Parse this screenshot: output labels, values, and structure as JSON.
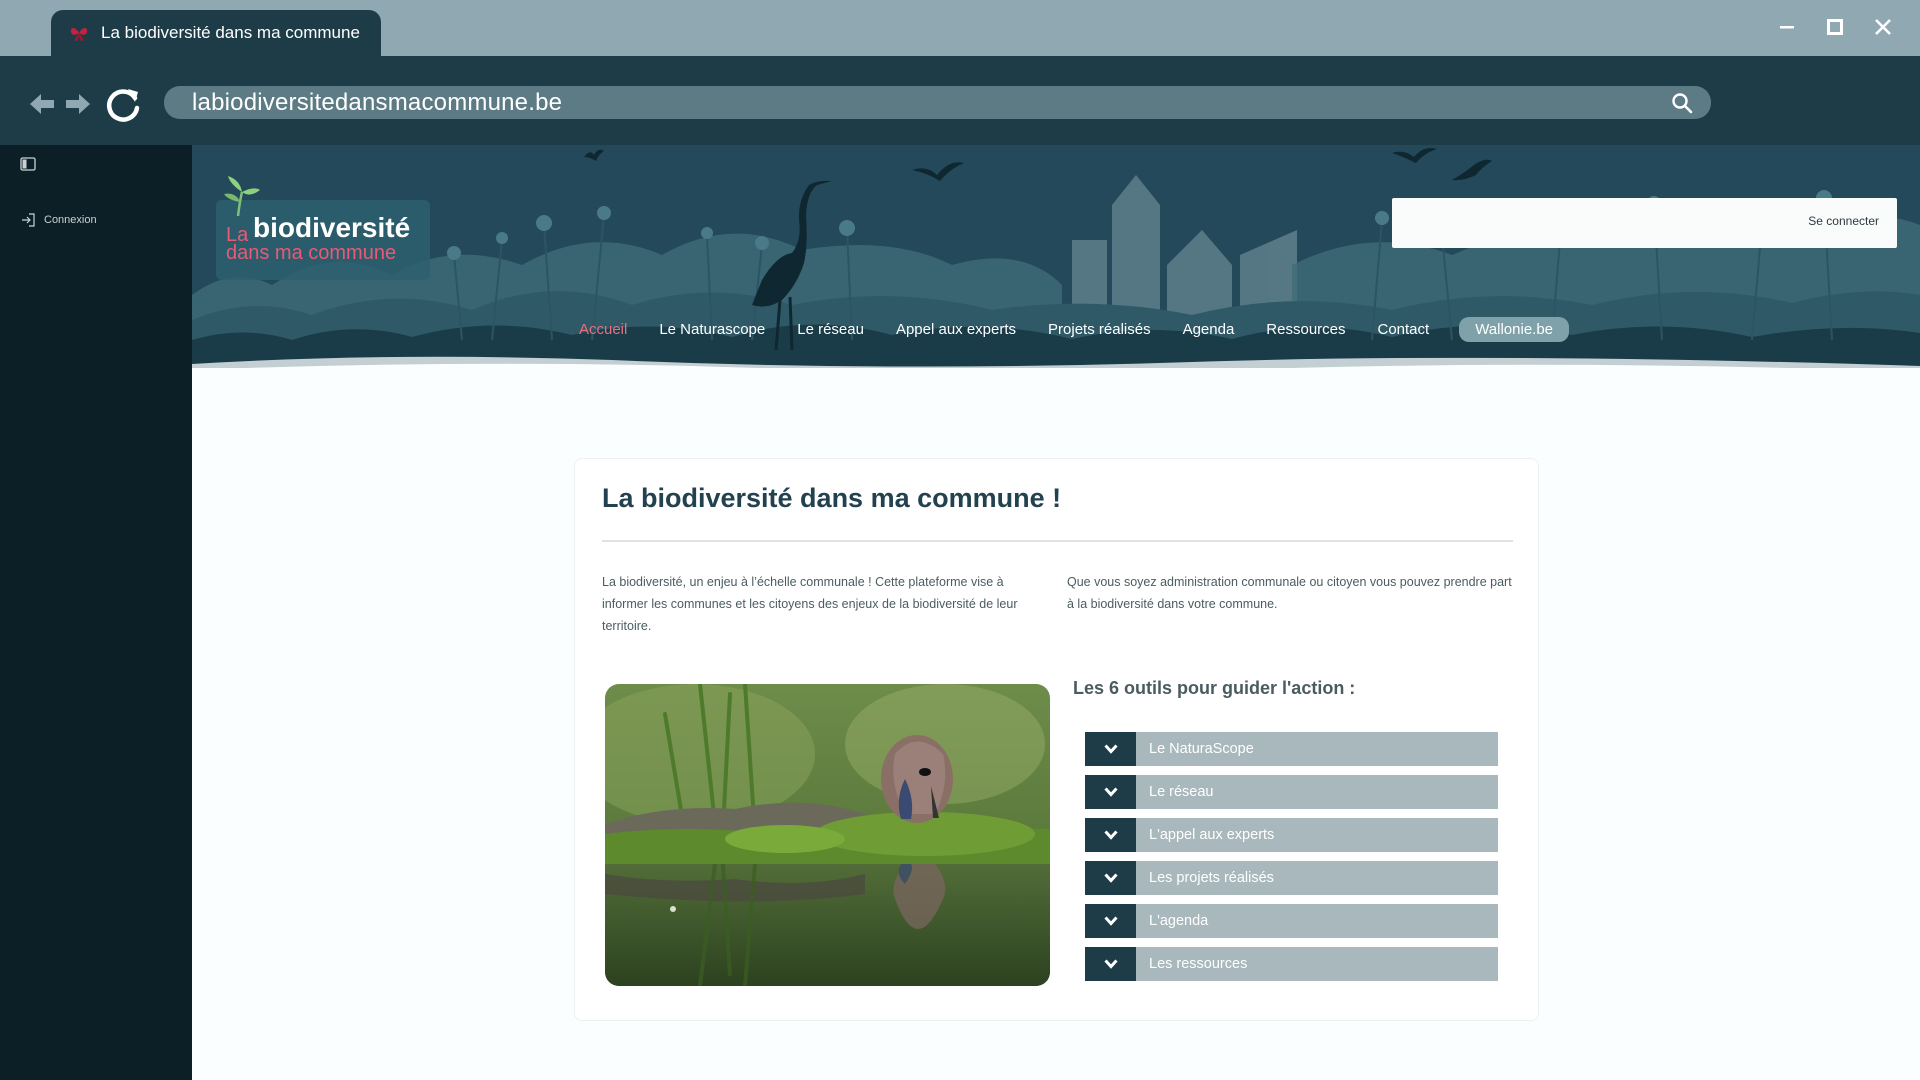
{
  "browser": {
    "tab_title": "La biodiversité dans ma commune",
    "url": "labiodiversitedansmacommune.be"
  },
  "sidebar": {
    "login_label": "Connexion"
  },
  "header": {
    "logo": {
      "la": "La",
      "main": "biodiversité",
      "sub": "dans ma commune"
    },
    "search_placeholder": "",
    "login_label": "Se connecter"
  },
  "menu": {
    "items": [
      {
        "label": "Accueil",
        "active": true
      },
      {
        "label": "Le Naturascope",
        "active": false
      },
      {
        "label": "Le réseau",
        "active": false
      },
      {
        "label": "Appel aux experts",
        "active": false
      },
      {
        "label": "Projets réalisés",
        "active": false
      },
      {
        "label": "Agenda",
        "active": false
      },
      {
        "label": "Ressources",
        "active": false
      },
      {
        "label": "Contact",
        "active": false
      }
    ],
    "highlight": "Wallonie.be"
  },
  "content": {
    "title": "La biodiversité dans ma commune !",
    "intro_left": "La biodiversité, un enjeu à l’échelle communale ! Cette plateforme vise à informer les communes et les citoyens des enjeux de la biodiversité de leur territoire.",
    "intro_right": "Que vous soyez administration communale ou citoyen vous pouvez prendre part à la biodiversité dans votre commune.",
    "tools_heading": "Les 6 outils pour guider l'action :",
    "tools": [
      "Le NaturaScope",
      "Le réseau",
      "L'appel aux experts",
      "Les projets réalisés",
      "L'agenda",
      "Les ressources"
    ]
  },
  "colors": {
    "chrome_bg": "#8fa8b2",
    "toolbar_bg": "#1d3c48",
    "sidebar_bg": "#0c1f26",
    "accent_pink": "#e86f80",
    "accordion_toggle": "#1d3c48",
    "accordion_label_bg": "#a9b8bc"
  },
  "icons": [
    "butterfly-favicon-icon",
    "minimize-icon",
    "maximize-icon",
    "close-icon",
    "back-arrow-icon",
    "forward-arrow-icon",
    "reload-icon",
    "search-icon",
    "sidebar-panel-icon",
    "login-icon",
    "chevron-down-icon"
  ]
}
